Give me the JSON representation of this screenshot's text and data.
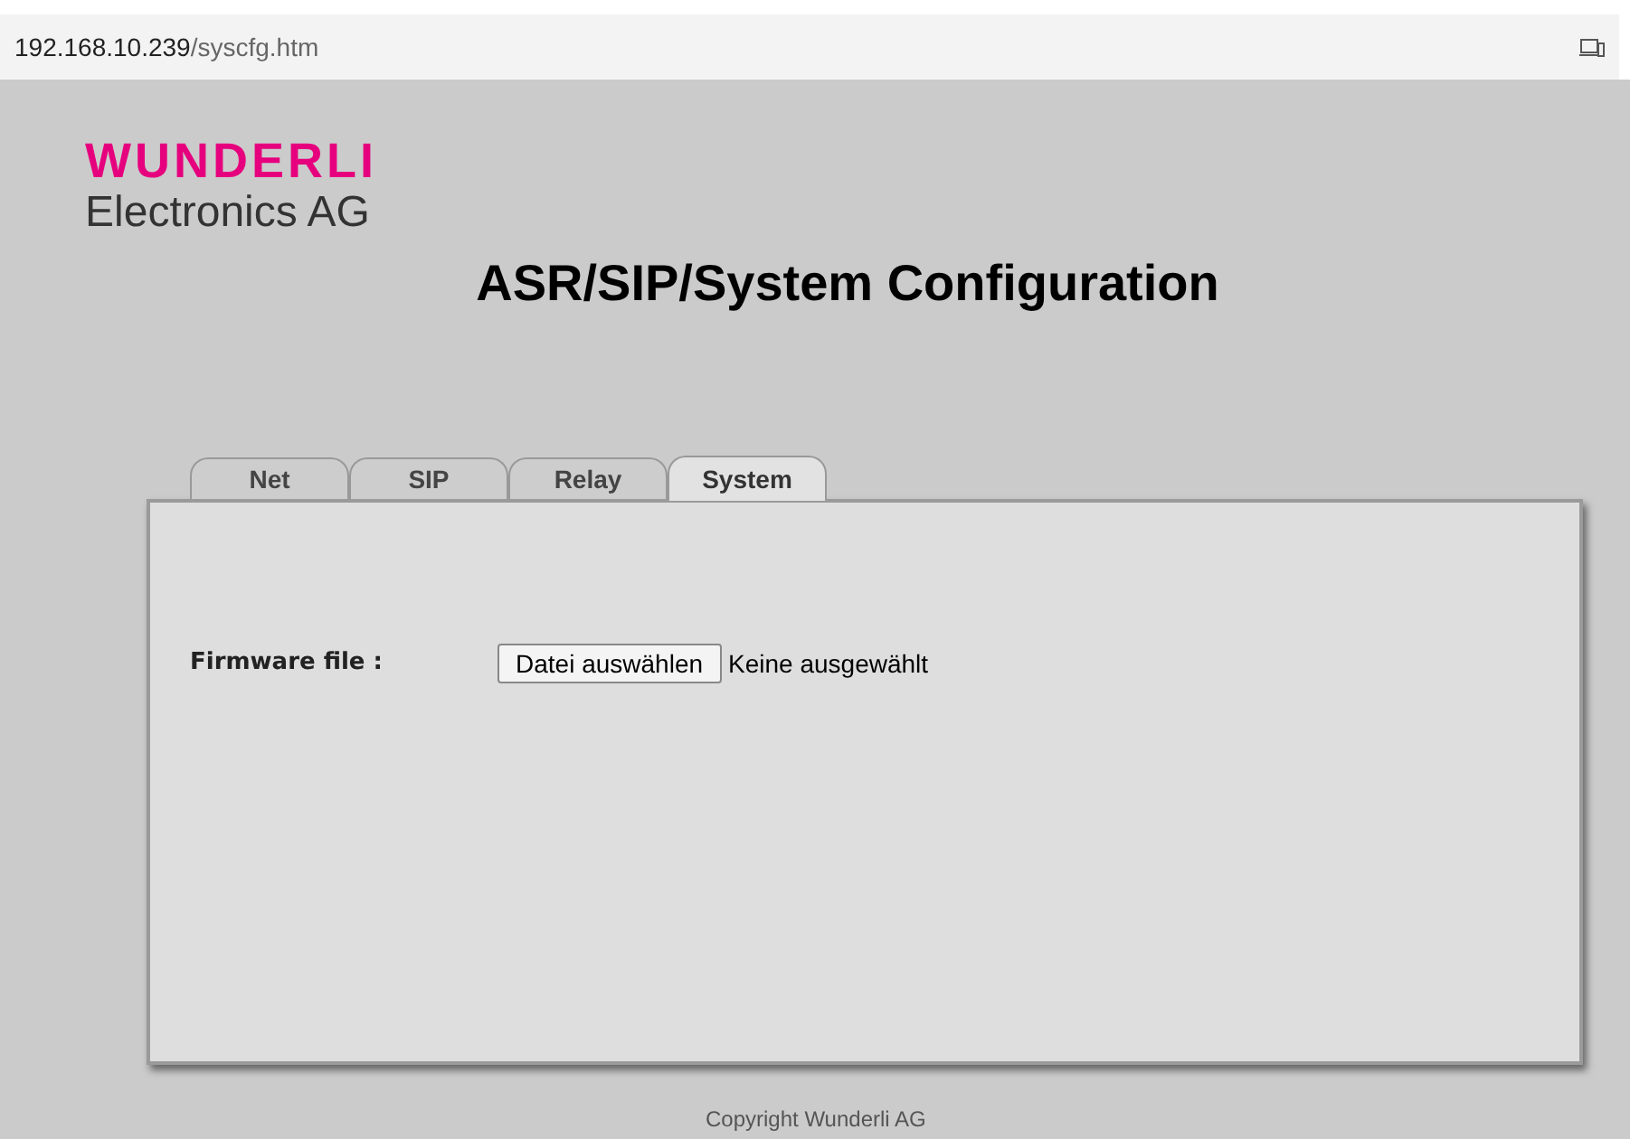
{
  "address_bar": {
    "host": "192.168.10.239",
    "path": "/syscfg.htm"
  },
  "logo": {
    "brand": "WUNDERLI",
    "subtitle": "Electronics AG"
  },
  "title": "ASR/SIP/System Configuration",
  "tabs": [
    {
      "label": "Net",
      "selected": false
    },
    {
      "label": "SIP",
      "selected": false
    },
    {
      "label": "Relay",
      "selected": false
    },
    {
      "label": "System",
      "selected": true
    }
  ],
  "firmware": {
    "label": "Firmware file :",
    "button": "Datei auswählen",
    "status": "Keine ausgewählt"
  },
  "footer": "Copyright Wunderli AG"
}
